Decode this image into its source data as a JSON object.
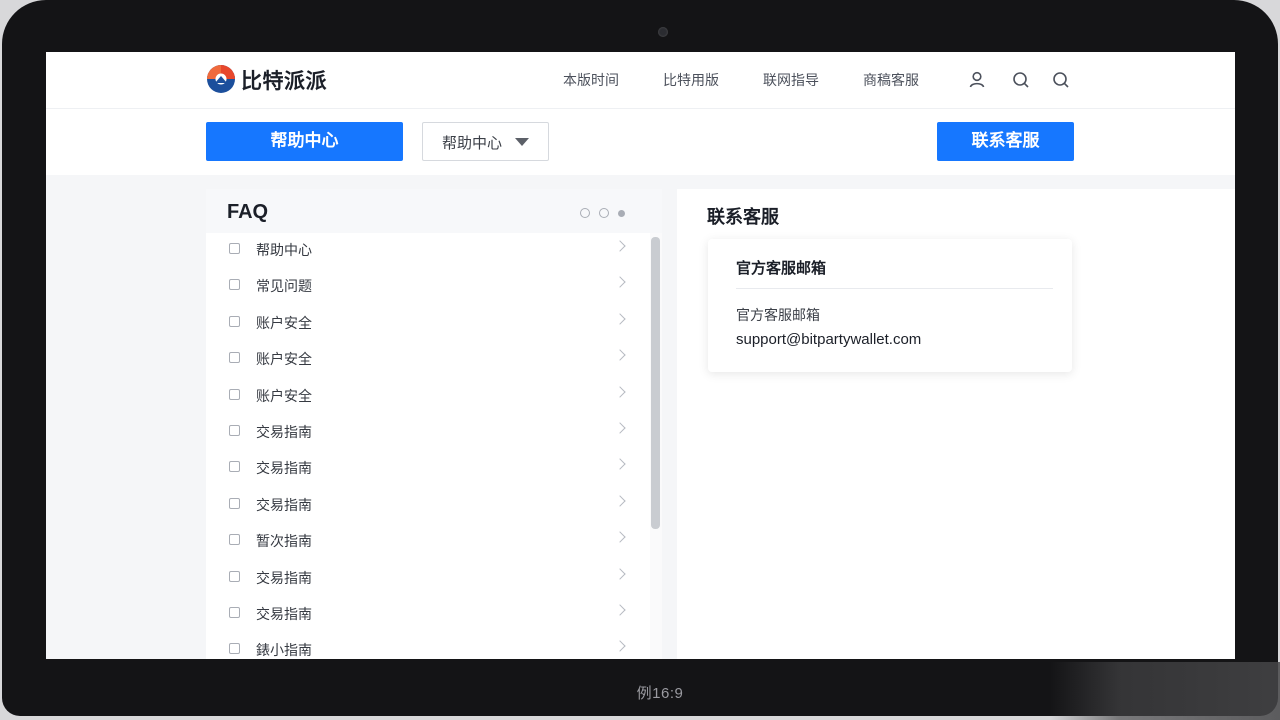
{
  "device": {
    "chin_label": "例16:9",
    "accent_color": "#1677ff"
  },
  "header": {
    "brand": "比特派派",
    "nav": [
      "本版时间",
      "比特用版",
      "联网指导",
      "商稿客服"
    ],
    "icons": [
      "user-icon",
      "search-icon",
      "search-icon"
    ]
  },
  "toolbar": {
    "help_center_button": "帮助中心",
    "category_select": {
      "value": "帮助中心"
    },
    "contact_button": "联系客服"
  },
  "faq": {
    "title": "FAQ",
    "items": [
      "帮助中心",
      "常见问题",
      "账户安全",
      "账户安全",
      "账户安全",
      "交易指南",
      "交易指南",
      "交易指南",
      "暂次指南",
      "交易指南",
      "交易指南",
      "錶小指南"
    ]
  },
  "contact": {
    "title": "联系客服",
    "card": {
      "title": "官方客服邮箱",
      "label": "官方客服邮箱",
      "email": "support@bitpartywallet.com"
    }
  }
}
